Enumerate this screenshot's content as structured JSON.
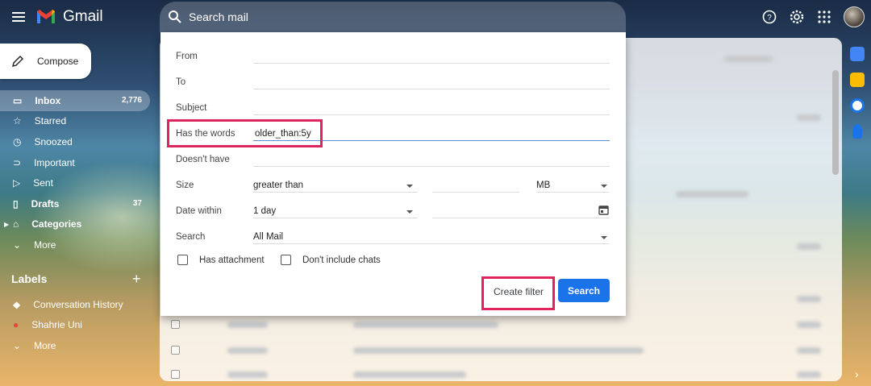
{
  "app": {
    "logo_text": "Gmail"
  },
  "search": {
    "placeholder": "Search mail"
  },
  "compose": {
    "label": "Compose"
  },
  "sidebar": {
    "items": [
      {
        "label": "Inbox",
        "count": "2,776",
        "icon": "inbox-icon"
      },
      {
        "label": "Starred",
        "icon": "star-icon"
      },
      {
        "label": "Snoozed",
        "icon": "clock-icon"
      },
      {
        "label": "Important",
        "icon": "important-icon"
      },
      {
        "label": "Sent",
        "icon": "send-icon"
      },
      {
        "label": "Drafts",
        "count": "37",
        "icon": "draft-icon"
      },
      {
        "label": "Categories",
        "icon": "label-icon"
      },
      {
        "label": "More",
        "icon": "chevron-down-icon"
      }
    ],
    "labels_heading": "Labels",
    "labels": [
      {
        "label": "Conversation History",
        "color": "#ffffff"
      },
      {
        "label": "Shahrie Uni",
        "color": "#e8453c"
      },
      {
        "label": "More"
      }
    ]
  },
  "dialog": {
    "fields": {
      "from": {
        "label": "From",
        "value": ""
      },
      "to": {
        "label": "To",
        "value": ""
      },
      "subject": {
        "label": "Subject",
        "value": ""
      },
      "has_words": {
        "label": "Has the words",
        "value": "older_than:5y"
      },
      "doesnt_have": {
        "label": "Doesn't have",
        "value": ""
      },
      "size": {
        "label": "Size",
        "comparator": "greater than",
        "unit": "MB"
      },
      "date_within": {
        "label": "Date within",
        "value": "1 day"
      },
      "search_in": {
        "label": "Search",
        "value": "All Mail"
      }
    },
    "has_attachment": {
      "label": "Has attachment",
      "checked": false
    },
    "dont_include_chats": {
      "label": "Don't include chats",
      "checked": false
    },
    "create_filter_label": "Create filter",
    "search_label": "Search"
  },
  "colors": {
    "accent": "#1a73e8",
    "highlight": "#e0245e"
  }
}
